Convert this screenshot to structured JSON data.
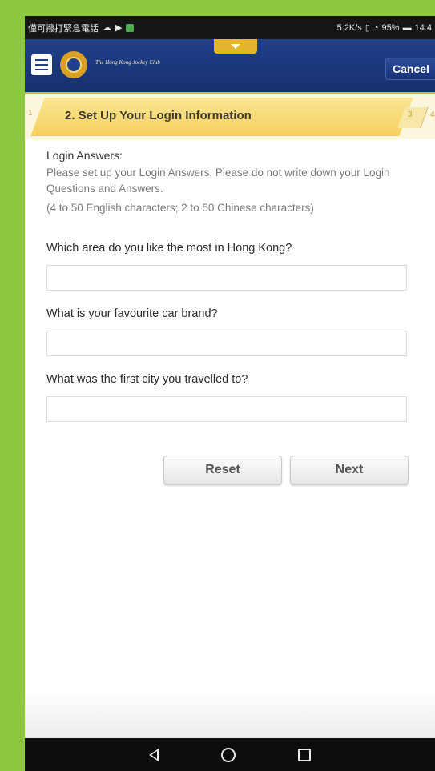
{
  "status_bar": {
    "carrier_text": "僅可撥打緊急電話",
    "network_speed": "5.2K/s",
    "battery": "95%",
    "time": "14:4"
  },
  "header": {
    "brand_text": "The Hong Kong Jockey Club",
    "cancel_label": "Cancel"
  },
  "steps": {
    "previous": "1",
    "current": "2. Set Up Your Login Information",
    "next": "3",
    "last": "4"
  },
  "form": {
    "section_title": "Login Answers:",
    "instructions": "Please set up your Login Answers. Please do not write down your Login Questions and Answers.",
    "limits": "(4 to 50 English characters; 2 to 50 Chinese characters)",
    "questions": [
      {
        "label": "Which area do you like the most in Hong Kong?",
        "value": ""
      },
      {
        "label": "What is your favourite car brand?",
        "value": ""
      },
      {
        "label": "What was the first city you travelled to?",
        "value": ""
      }
    ],
    "reset_label": "Reset",
    "next_label": "Next"
  }
}
